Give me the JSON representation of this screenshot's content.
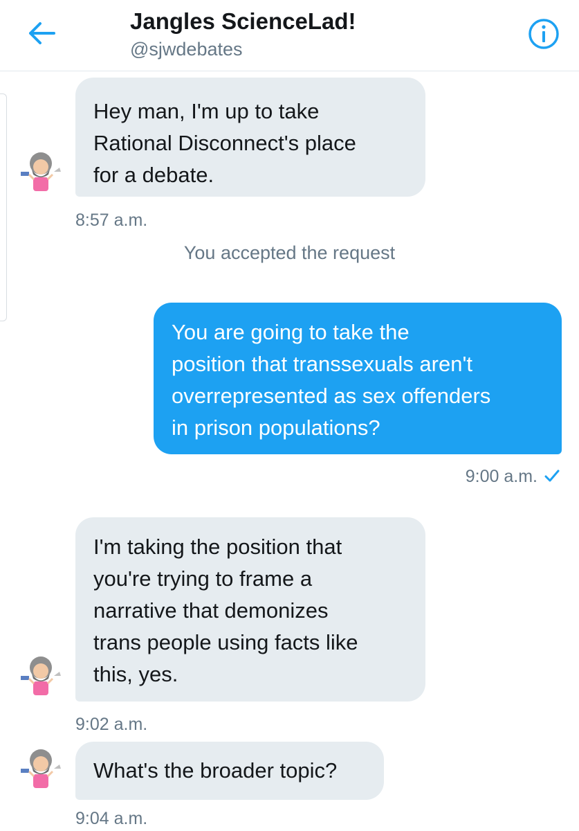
{
  "header": {
    "title": "Jangles ScienceLad!",
    "handle": "@sjwdebates",
    "back_icon": "arrow-left-icon",
    "info_icon": "info-icon",
    "accent_color": "#1da1f2"
  },
  "messages": [
    {
      "direction": "incoming",
      "text": "Hey man, I'm up to take\nRational Disconnect's place\nfor a debate.",
      "time": "8:57 a.m."
    },
    {
      "direction": "outgoing",
      "text": "You are going to take the\nposition that transsexuals aren't\noverrepresented as sex offenders\nin prison populations?",
      "time": "9:00 a.m.",
      "status_icon": "check-icon"
    },
    {
      "direction": "incoming",
      "text": "I'm taking the position that\nyou're trying to frame a\nnarrative that demonizes\ntrans people using facts like\nthis, yes.",
      "time": "9:02 a.m."
    },
    {
      "direction": "incoming",
      "text": "What's the broader topic?",
      "time": "9:04 a.m."
    }
  ],
  "system_note": "You accepted the request",
  "avatar_icon": "cartoon-avatar-icon"
}
